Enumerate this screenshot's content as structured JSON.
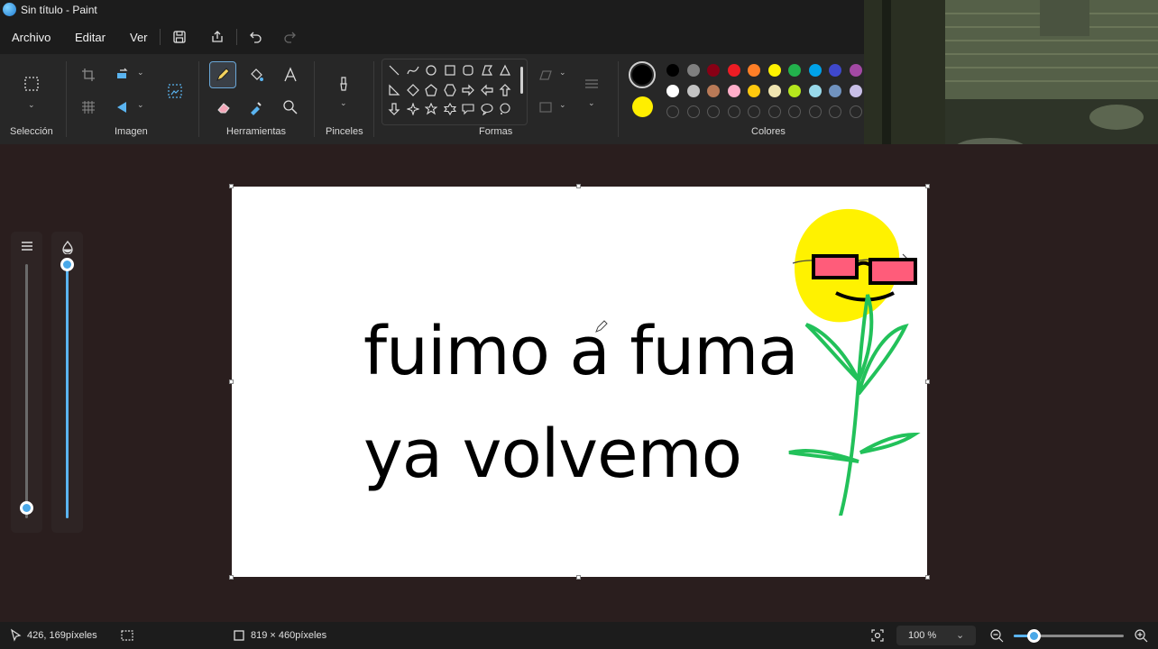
{
  "window": {
    "title": "Sin título - Paint"
  },
  "menu": {
    "file": "Archivo",
    "edit": "Editar",
    "view": "Ver"
  },
  "ribbon": {
    "groups": {
      "selection": "Selección",
      "image": "Imagen",
      "tools": "Herramientas",
      "brushes": "Pinceles",
      "shapes": "Formas",
      "colors": "Colores"
    },
    "active_tool": "pencil"
  },
  "colors": {
    "color1": "#000000",
    "color2": "#ffee00",
    "palette_row1": [
      "#000000",
      "#7f7f7f",
      "#880015",
      "#ed1c24",
      "#ff7f27",
      "#fff200",
      "#22b14c",
      "#00a2e8",
      "#3f48cc",
      "#a349a4"
    ],
    "palette_row2": [
      "#ffffff",
      "#c3c3c3",
      "#b97a57",
      "#ffaec9",
      "#ffc90e",
      "#efe4b0",
      "#b5e61d",
      "#99d9ea",
      "#7092be",
      "#c8bfe7"
    ],
    "custom_slots": 10
  },
  "canvas": {
    "line1": "fuimo a fuma",
    "line2": "ya volvemo"
  },
  "sidebar": {
    "size_slider_level": 0,
    "opacity_slider_level": 1
  },
  "status": {
    "cursor_position": "426, 169píxeles",
    "canvas_size": "819 × 460píxeles",
    "zoom": "100 %",
    "zoom_level": 0.18
  }
}
